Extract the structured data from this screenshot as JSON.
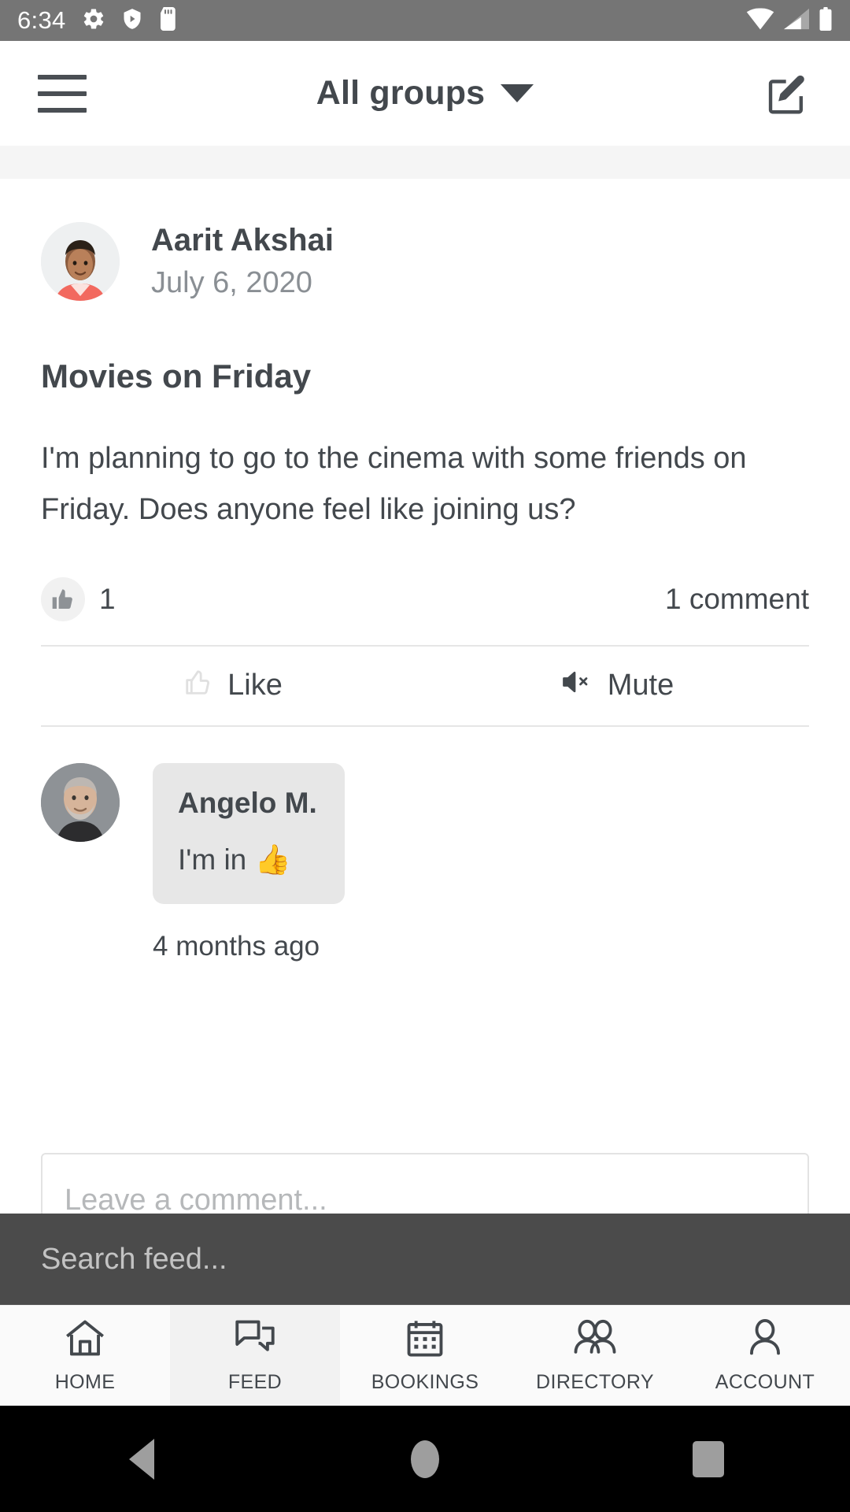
{
  "status_bar": {
    "time": "6:34",
    "left_icons": [
      "gear-icon",
      "shield-play-icon",
      "sd-card-icon"
    ],
    "right_icons": [
      "wifi-icon",
      "cellular-signal-icon",
      "battery-icon"
    ],
    "background": "#757575"
  },
  "header": {
    "menu_icon": "hamburger-menu-icon",
    "title": "All groups",
    "dropdown_icon": "chevron-down-icon",
    "compose_icon": "compose-edit-icon"
  },
  "post": {
    "author": "Aarit Akshai",
    "date": "July 6, 2020",
    "title": "Movies on Friday",
    "body": "I'm planning to go to the cinema with some friends on Friday. Does anyone feel like joining us?",
    "like_count": "1",
    "comment_count": "1 comment",
    "actions": [
      {
        "label": "Like",
        "icon": "thumbs-up-outline-icon"
      },
      {
        "label": "Mute",
        "icon": "speaker-mute-icon"
      }
    ]
  },
  "comment": {
    "author": "Angelo M.",
    "text": "I'm in 👍",
    "time": "4 months ago"
  },
  "comment_input": {
    "placeholder": "Leave a comment..."
  },
  "search": {
    "placeholder": "Search feed...",
    "background": "#4b4b4b"
  },
  "bottom_nav": {
    "items": [
      {
        "label": "HOME",
        "icon": "home-icon",
        "active": false
      },
      {
        "label": "FEED",
        "icon": "chat-bubbles-icon",
        "active": true
      },
      {
        "label": "BOOKINGS",
        "icon": "calendar-icon",
        "active": false
      },
      {
        "label": "DIRECTORY",
        "icon": "people-icon",
        "active": false
      },
      {
        "label": "ACCOUNT",
        "icon": "person-icon",
        "active": false
      }
    ]
  },
  "android_nav": {
    "back": "back-triangle-icon",
    "home": "home-circle-icon",
    "recents": "recents-square-icon"
  },
  "colors": {
    "text_primary": "#43484d",
    "text_muted": "#8a8f94",
    "status_bar": "#757575",
    "search_bar": "#4b4b4b",
    "bubble": "#e7e7e7"
  }
}
